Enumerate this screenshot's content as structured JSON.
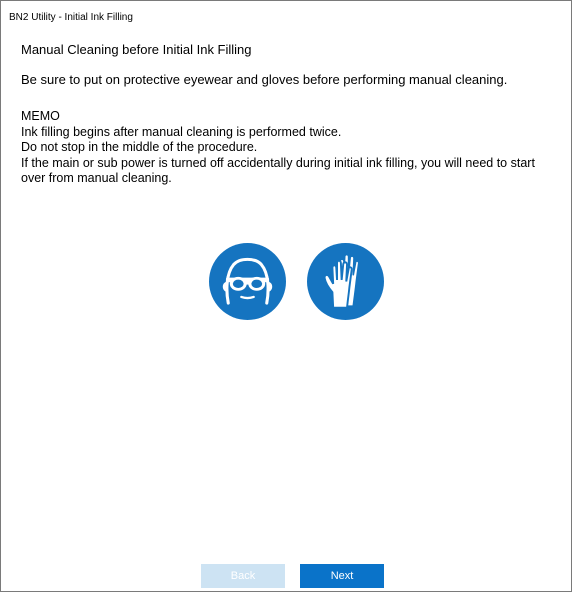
{
  "window": {
    "title": "BN2 Utility - Initial Ink Filling"
  },
  "content": {
    "heading": "Manual Cleaning before Initial Ink Filling",
    "warning": "Be sure to put on protective eyewear and gloves before performing manual cleaning.",
    "memo_title": "MEMO",
    "memo_lines": [
      "Ink filling begins after manual cleaning is performed twice.",
      "Do not stop in the middle of the procedure.",
      "If the main or sub power is turned off accidentally during initial ink filling, you will need to start over from manual cleaning."
    ]
  },
  "icons": [
    {
      "name": "eyewear-icon",
      "color": "#1574c0"
    },
    {
      "name": "gloves-icon",
      "color": "#1574c0"
    }
  ],
  "buttons": {
    "back_label": "Back",
    "back_enabled": false,
    "next_label": "Next"
  },
  "colors": {
    "accent": "#0a73c9",
    "disabled": "#cde3f3",
    "safety_blue": "#1574c0"
  }
}
